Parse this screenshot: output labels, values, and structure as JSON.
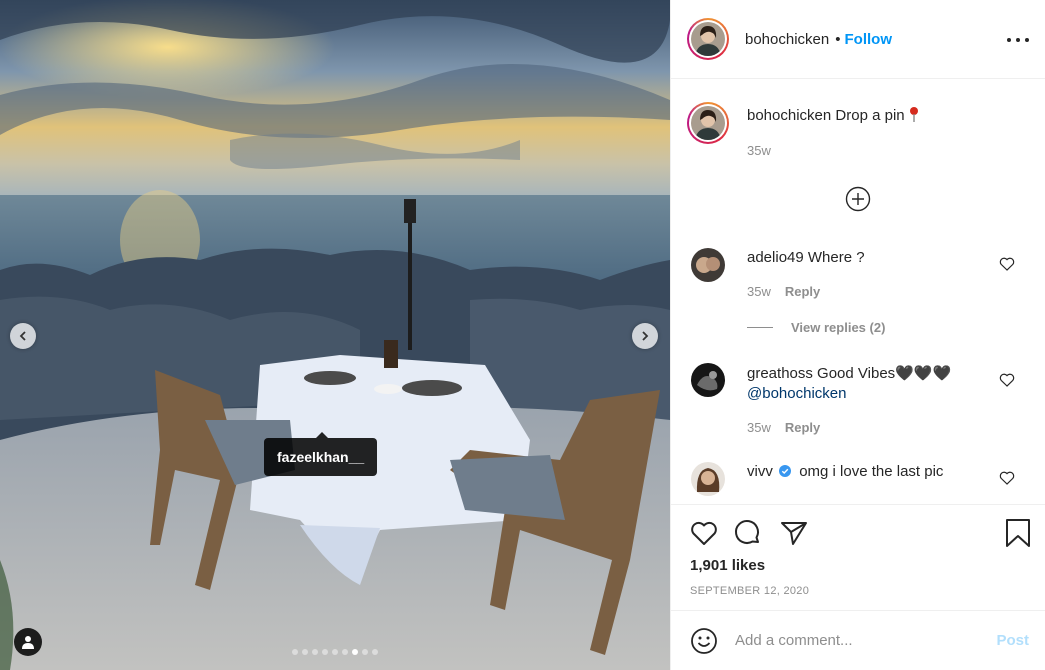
{
  "photo": {
    "tag_label": "fazeelkhan__",
    "carousel": {
      "count": 9,
      "active_index": 6
    },
    "icons": {
      "prev": "chevron-left-icon",
      "next": "chevron-right-icon",
      "user_tag": "user-icon"
    }
  },
  "header": {
    "username": "bohochicken",
    "separator": "•",
    "follow_label": "Follow",
    "more_icon": "more-horizontal-icon"
  },
  "caption": {
    "username": "bohochicken",
    "text": "Drop a pin",
    "emoji_icon": "round-pushpin-icon",
    "age": "35w"
  },
  "load_more_icon": "plus-circle-icon",
  "comments": [
    {
      "username": "adelio49",
      "text": "Where ?",
      "age": "35w",
      "reply_label": "Reply",
      "view_replies": "View replies (2)"
    },
    {
      "username": "greathoss",
      "text": "Good Vibes",
      "hearts": "🖤🖤🖤",
      "mention": "@bohochicken",
      "age": "35w",
      "reply_label": "Reply"
    },
    {
      "username": "vivv",
      "verified": true,
      "text": "omg i love the last pic"
    }
  ],
  "actions": {
    "like_icon": "heart-icon",
    "comment_icon": "comment-icon",
    "share_icon": "paper-plane-icon",
    "save_icon": "bookmark-icon",
    "likes": "1,901 likes",
    "date": "SEPTEMBER 12, 2020"
  },
  "add_comment": {
    "placeholder": "Add a comment...",
    "post_label": "Post",
    "emoji_icon": "smiley-icon"
  },
  "colors": {
    "link_blue": "#0095f6",
    "post_disabled": "#b2dffc",
    "muted": "#8e8e8e",
    "text": "#262626"
  }
}
